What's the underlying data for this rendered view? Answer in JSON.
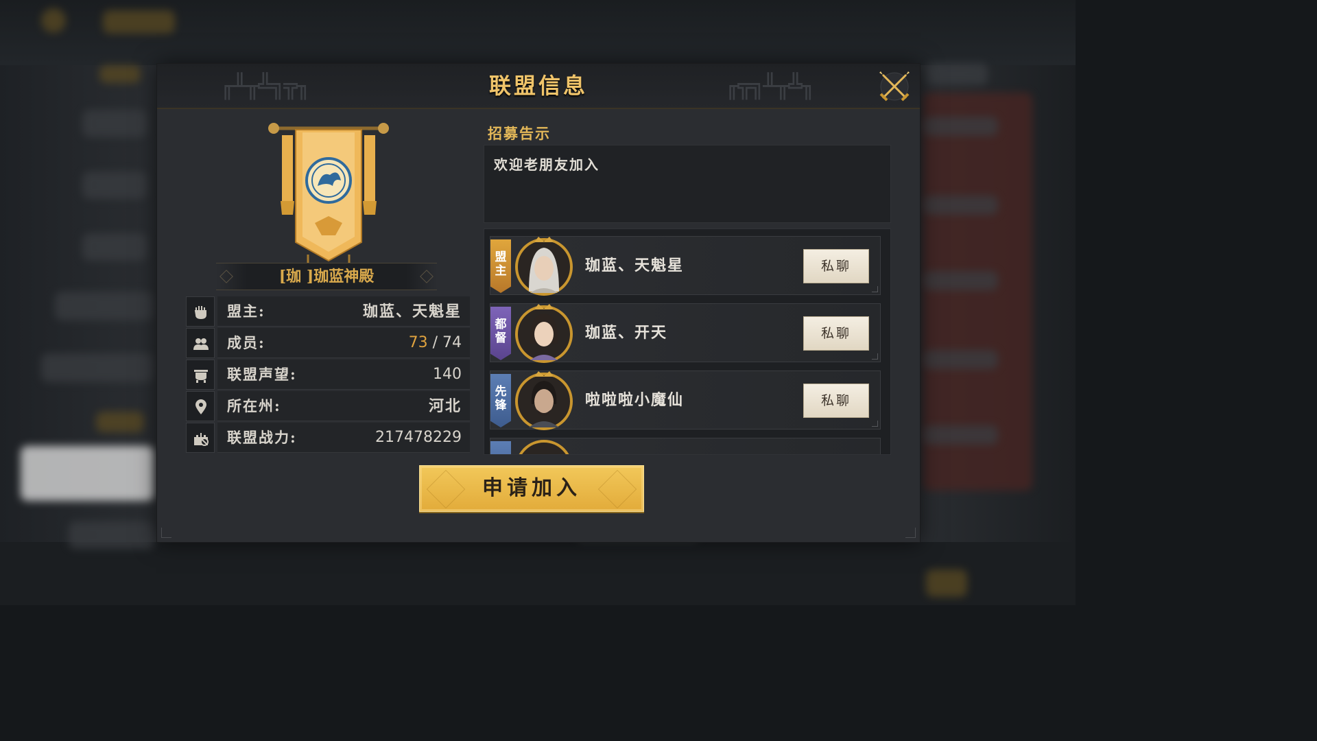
{
  "dialog": {
    "title": "联盟信息"
  },
  "alliance": {
    "name_plate": "[珈 ]珈蓝神殿"
  },
  "info": [
    {
      "label": "盟主:",
      "value": "珈蓝、天魁星",
      "icon": "hand-icon"
    },
    {
      "label": "成员:",
      "current": "73",
      "separator": " / ",
      "max": "74",
      "icon": "members-icon"
    },
    {
      "label": "联盟声望:",
      "value": "140",
      "icon": "cauldron-icon"
    },
    {
      "label": "所在州:",
      "value": "河北",
      "icon": "location-pin-icon"
    },
    {
      "label": "联盟战力:",
      "value": "217478229",
      "icon": "fortress-icon"
    }
  ],
  "recruit": {
    "title": "招募告示",
    "text": "欢迎老朋友加入"
  },
  "members": [
    {
      "rank": "盟主",
      "rank_color": "#d99a35",
      "name": "珈蓝、天魁星",
      "chat_label": "私聊"
    },
    {
      "rank": "都督",
      "rank_color": "#6f58a6",
      "name": "珈蓝、开天",
      "chat_label": "私聊"
    },
    {
      "rank": "先锋",
      "rank_color": "#4e6fa4",
      "name": "啦啦啦小魔仙",
      "chat_label": "私聊"
    }
  ],
  "join_button": {
    "label": "申请加入"
  },
  "colors": {
    "accent_gold": "#f0c46a",
    "button_gold": "#e9b84a",
    "member_count": "#e0a33f"
  }
}
